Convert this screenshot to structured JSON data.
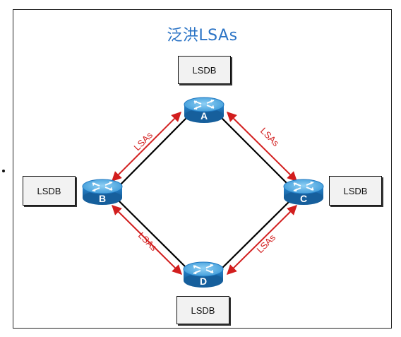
{
  "title": "泛洪LSAs",
  "lsdb_label": "LSDB",
  "lsa_label": "LSAs",
  "routers": [
    {
      "letter": "A",
      "icon": "router-icon"
    },
    {
      "letter": "B",
      "icon": "router-icon"
    },
    {
      "letter": "C",
      "icon": "router-icon"
    },
    {
      "letter": "D",
      "icon": "router-icon"
    }
  ],
  "colors": {
    "title": "#2a73c5",
    "lsa_arrow": "#d21e1e",
    "link": "#000000",
    "router_top": "#5fb0e8",
    "router_body": "#1f78c1"
  }
}
